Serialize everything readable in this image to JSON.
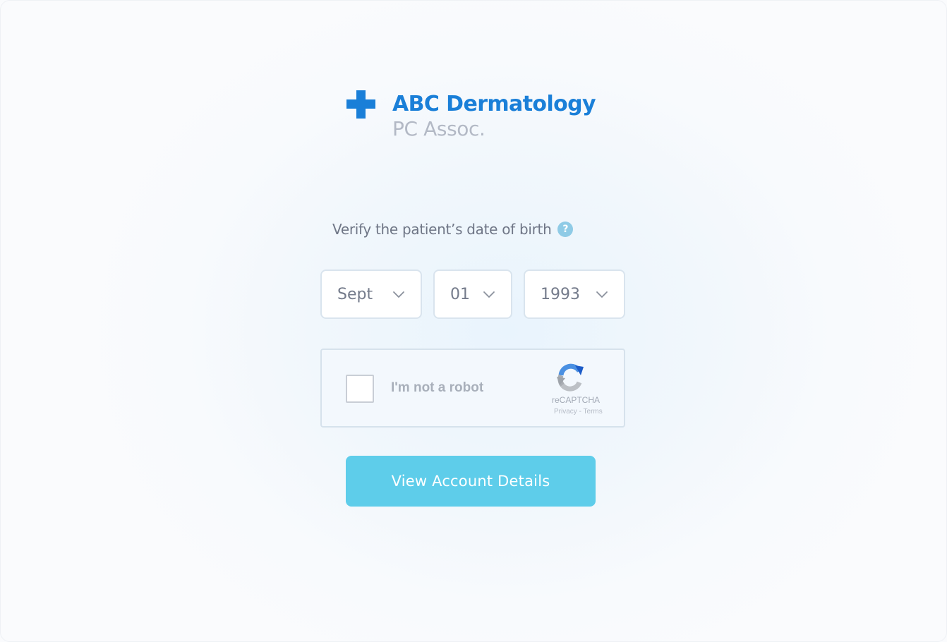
{
  "brand": {
    "name": "ABC Dermatology",
    "subtitle": "PC Assoc.",
    "color": "#1a7fd8",
    "icon": "medical-cross-icon"
  },
  "prompt": {
    "text": "Verify the patient’s date of birth",
    "help_icon": "?"
  },
  "dob": {
    "month": {
      "selected": "Sept"
    },
    "day": {
      "selected": "01"
    },
    "year": {
      "selected": "1993"
    }
  },
  "captcha": {
    "label": "I'm not a robot",
    "checked": false,
    "brand": "reCAPTCHA",
    "privacy": "Privacy",
    "separator": " - ",
    "terms": "Terms"
  },
  "actions": {
    "view_details_label": "View Account Details",
    "button_color": "#5ecdea"
  }
}
